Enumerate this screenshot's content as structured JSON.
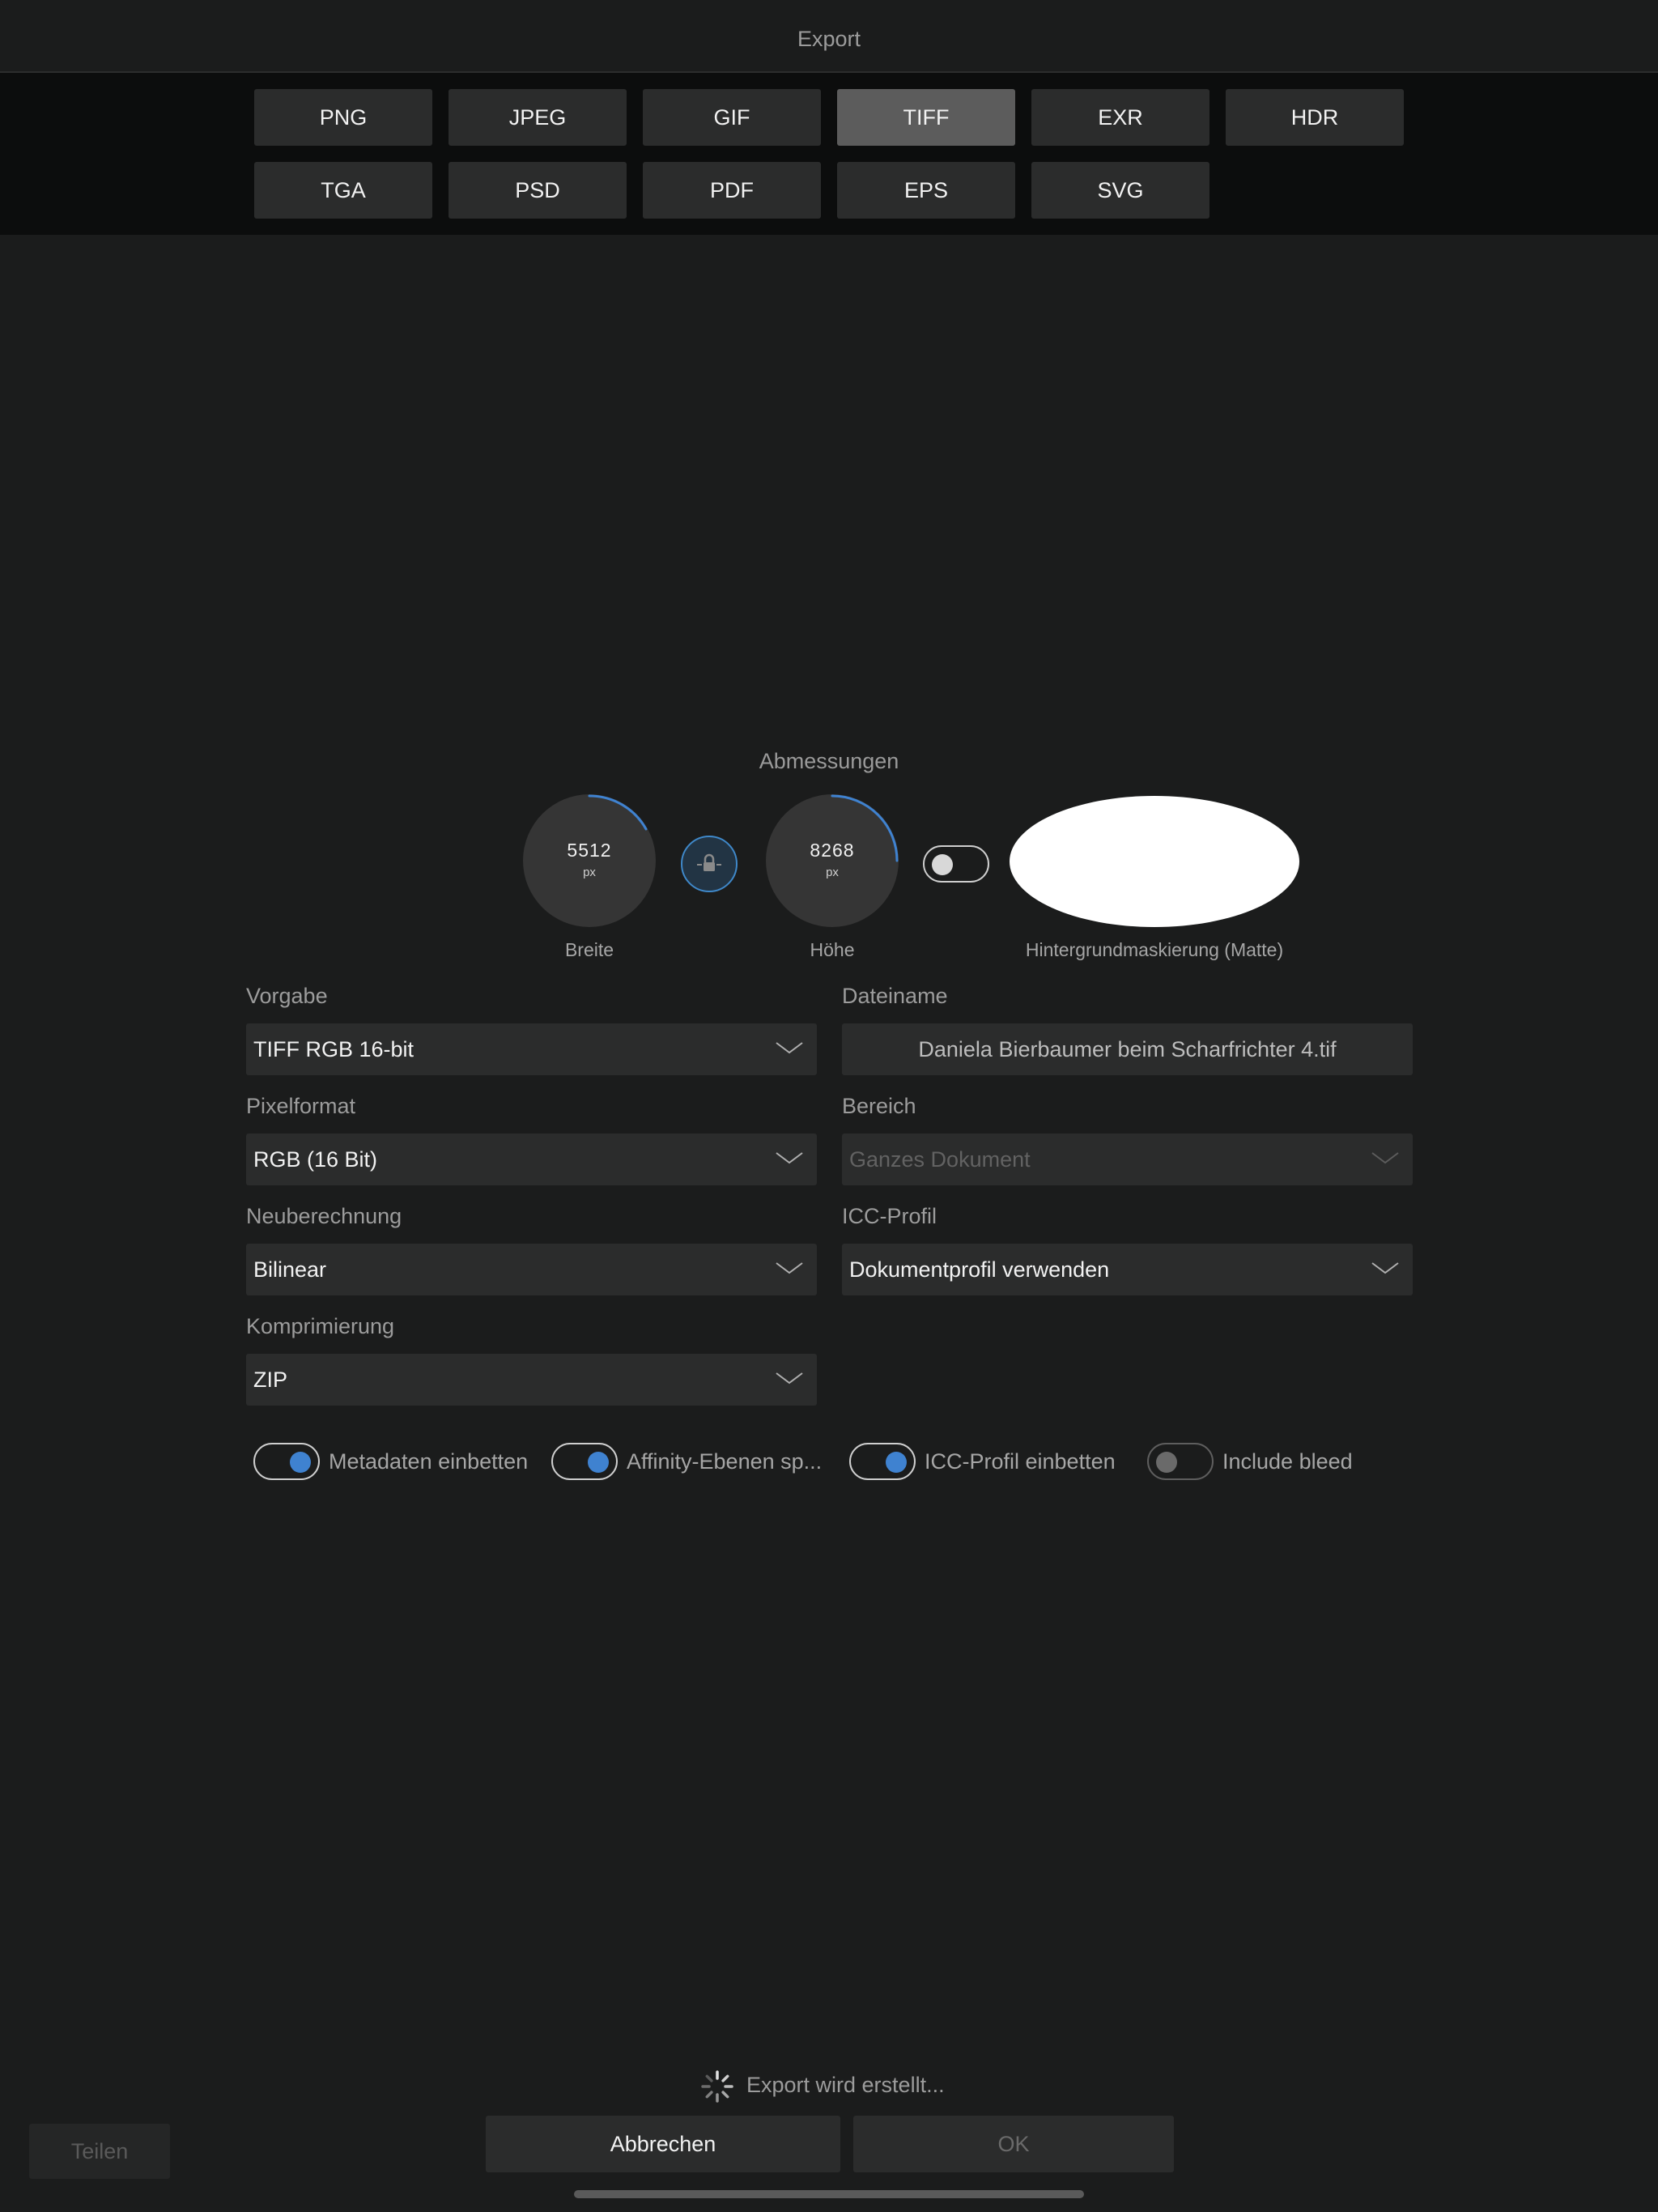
{
  "header": {
    "title": "Export"
  },
  "formats": {
    "row1": [
      "PNG",
      "JPEG",
      "GIF",
      "TIFF",
      "EXR",
      "HDR"
    ],
    "row2": [
      "TGA",
      "PSD",
      "PDF",
      "EPS",
      "SVG"
    ],
    "selected": "TIFF"
  },
  "dimensions": {
    "title": "Abmessungen",
    "width": {
      "value": "5512",
      "unit": "px",
      "label": "Breite"
    },
    "height": {
      "value": "8268",
      "unit": "px",
      "label": "Höhe"
    },
    "matte_label": "Hintergrundmaskierung (Matte)"
  },
  "fields": {
    "preset": {
      "label": "Vorgabe",
      "value": "TIFF RGB 16-bit"
    },
    "filename": {
      "label": "Dateiname",
      "value": "Daniela Bierbaumer beim Scharfrichter 4.tif"
    },
    "pixel_format": {
      "label": "Pixelformat",
      "value": "RGB (16 Bit)"
    },
    "area": {
      "label": "Bereich",
      "value": "Ganzes Dokument"
    },
    "resampling": {
      "label": "Neuberechnung",
      "value": "Bilinear"
    },
    "icc_profile": {
      "label": "ICC-Profil",
      "value": "Dokumentprofil verwenden"
    },
    "compression": {
      "label": "Komprimierung",
      "value": "ZIP"
    }
  },
  "options": {
    "embed_metadata": {
      "label": "Metadaten einbetten",
      "on": true
    },
    "affinity_layers": {
      "label": "Affinity-Ebenen sp...",
      "on": true
    },
    "embed_icc": {
      "label": "ICC-Profil einbetten",
      "on": true
    },
    "include_bleed": {
      "label": "Include bleed",
      "on": false
    }
  },
  "footer": {
    "status": "Export wird erstellt...",
    "cancel_label": "Abbrechen",
    "ok_label": "OK",
    "share_label": "Teilen"
  },
  "colors": {
    "background": "#1b1c1c",
    "strip": "#0c0d0d",
    "accent": "#3f82d0",
    "field": "#2b2c2c"
  }
}
